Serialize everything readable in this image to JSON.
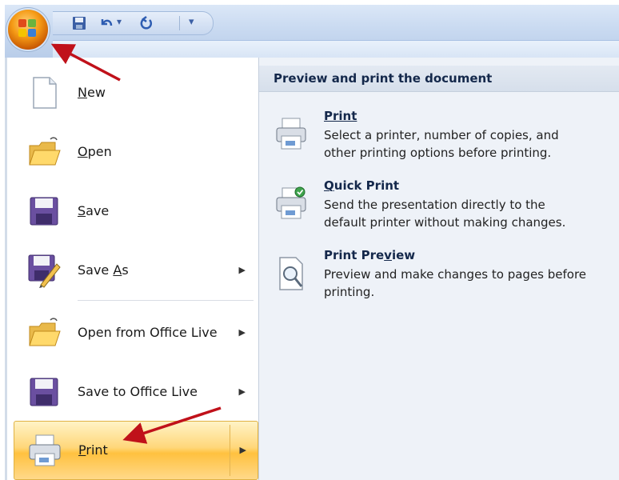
{
  "quick_access_toolbar": {
    "icons": [
      "save-icon",
      "undo-icon",
      "dropdown-icon",
      "redo-icon",
      "customize-icon"
    ],
    "dropdown_glyph": "▾",
    "customize_glyph": "▾"
  },
  "office_menu": {
    "items": [
      {
        "label": "New",
        "mnemonic": "N",
        "icon": "new-document-icon",
        "has_submenu": false
      },
      {
        "label": "Open",
        "mnemonic": "O",
        "icon": "open-folder-icon",
        "has_submenu": false
      },
      {
        "label": "Save",
        "mnemonic": "S",
        "icon": "save-icon",
        "has_submenu": false
      },
      {
        "label": "Save As",
        "mnemonic": "A",
        "icon": "save-as-icon",
        "has_submenu": true
      },
      {
        "label": "Open from Office Live",
        "icon": "open-folder-icon",
        "has_submenu": true
      },
      {
        "label": "Save to Office Live",
        "icon": "save-icon",
        "has_submenu": true
      },
      {
        "label": "Print",
        "mnemonic": "P",
        "icon": "printer-icon",
        "has_submenu": true,
        "selected": true
      }
    ],
    "submenu_arrow": "▶"
  },
  "print_panel": {
    "header": "Preview and print the document",
    "options": [
      {
        "title": "Print",
        "description": "Select a printer, number of copies, and\nother printing options before printing.",
        "icon": "printer-icon"
      },
      {
        "title": "Quick Print",
        "description": "Send the presentation directly to the\ndefault printer without making changes.",
        "icon": "quick-print-icon"
      },
      {
        "title": "Print Preview",
        "description": "Preview and make changes to pages before\nprinting.",
        "icon": "print-preview-icon"
      }
    ]
  },
  "colors": {
    "annotation_arrow": "#c0111a",
    "selection_highlight": "#ffc13f",
    "header_text": "#14284b"
  }
}
